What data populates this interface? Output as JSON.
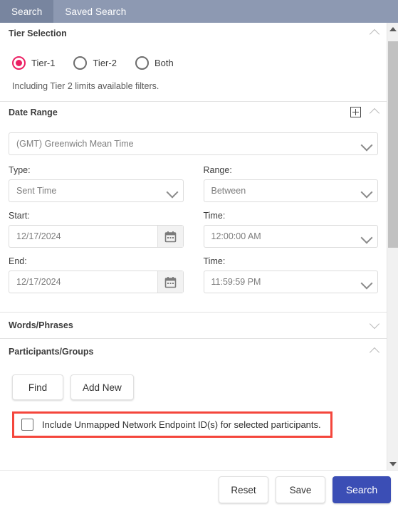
{
  "tabs": [
    {
      "label": "Search",
      "active": true
    },
    {
      "label": "Saved Search",
      "active": false
    }
  ],
  "tier_selection": {
    "title": "Tier Selection",
    "options": [
      {
        "label": "Tier-1",
        "selected": true
      },
      {
        "label": "Tier-2",
        "selected": false
      },
      {
        "label": "Both",
        "selected": false
      }
    ],
    "hint": "Including Tier 2 limits available filters.",
    "collapse_icon": "chevron-up-icon"
  },
  "date_range": {
    "title": "Date Range",
    "add_icon": "plus-square-icon",
    "collapse_icon": "chevron-up-icon",
    "timezone": "(GMT) Greenwich Mean Time",
    "type_label": "Type:",
    "type_value": "Sent Time",
    "range_label": "Range:",
    "range_value": "Between",
    "start_label": "Start:",
    "start_value": "12/17/2024",
    "start_time_label": "Time:",
    "start_time_value": "12:00:00 AM",
    "end_label": "End:",
    "end_value": "12/17/2024",
    "end_time_label": "Time:",
    "end_time_value": "11:59:59 PM",
    "calendar_icon": "calendar-icon"
  },
  "words_phrases": {
    "title": "Words/Phrases",
    "collapse_icon": "chevron-down-icon"
  },
  "participants_groups": {
    "title": "Participants/Groups",
    "collapse_icon": "chevron-up-icon",
    "find_label": "Find",
    "add_new_label": "Add New",
    "include_unmapped_label": "Include Unmapped Network Endpoint ID(s) for selected participants.",
    "include_unmapped_checked": false,
    "highlight_color": "#f4463c"
  },
  "footer": {
    "reset_label": "Reset",
    "save_label": "Save",
    "search_label": "Search",
    "primary_color": "#3b4eb5"
  },
  "scrollbar": {
    "up_icon": "scroll-up-arrow-icon",
    "down_icon": "scroll-down-arrow-icon"
  },
  "colors": {
    "tabbar": "#8d99b2",
    "tab_active": "#78859f",
    "radio_accent": "#ec1f63"
  }
}
